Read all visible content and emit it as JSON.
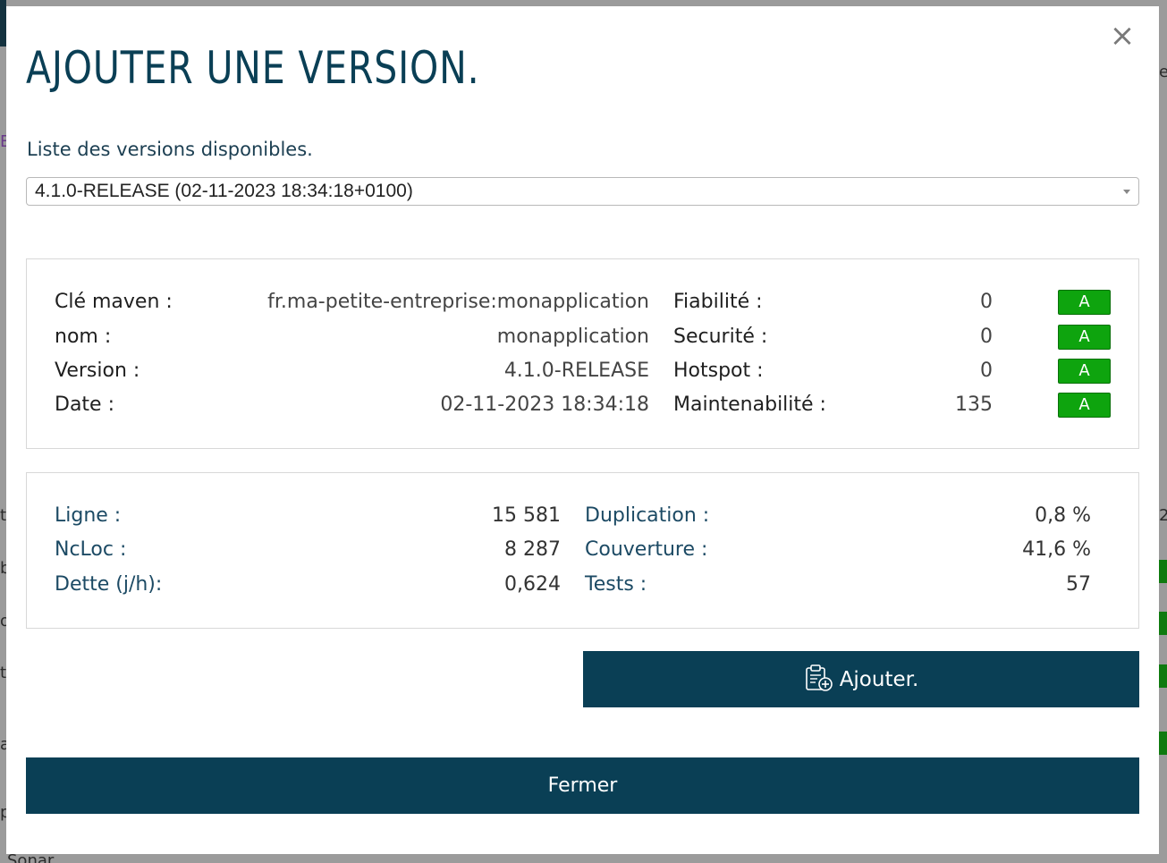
{
  "modal": {
    "title": "AJOUTER UNE VERSION.",
    "close_symbol": "×",
    "list_label": "Liste des versions disponibles.",
    "selected_version": "4.1.0-RELEASE (02-11-2023 18:34:18+0100)"
  },
  "info": {
    "rows": [
      {
        "label": "Clé maven :",
        "value": "fr.ma-petite-entreprise:monapplication"
      },
      {
        "label": "nom :",
        "value": "monapplication"
      },
      {
        "label": "Version :",
        "value": "4.1.0-RELEASE"
      },
      {
        "label": "Date :",
        "value": "02-11-2023 18:34:18"
      }
    ],
    "ratings": [
      {
        "label": "Fiabilité :",
        "value": "0",
        "grade": "A"
      },
      {
        "label": "Securité :",
        "value": "0",
        "grade": "A"
      },
      {
        "label": "Hotspot :",
        "value": "0",
        "grade": "A"
      },
      {
        "label": "Maintenabilité :",
        "value": "135",
        "grade": "A"
      }
    ]
  },
  "metrics": {
    "left": [
      {
        "label": "Ligne :",
        "value": "15 581"
      },
      {
        "label": "NcLoc :",
        "value": "8 287"
      },
      {
        "label": "Dette (j/h):",
        "value": "0,624"
      }
    ],
    "right": [
      {
        "label": "Duplication :",
        "value": "0,8 %"
      },
      {
        "label": "Couverture :",
        "value": "41,6 %"
      },
      {
        "label": "Tests :",
        "value": "57"
      }
    ]
  },
  "buttons": {
    "add_label": "Ajouter.",
    "close_label": "Fermer"
  },
  "colors": {
    "primary": "#0a3f55",
    "grade_a": "#0ea40e"
  },
  "background": {
    "fragments": [
      "E",
      "t",
      "b",
      "o",
      "t",
      "a",
      "p",
      "Sonar",
      "e",
      "2"
    ]
  }
}
